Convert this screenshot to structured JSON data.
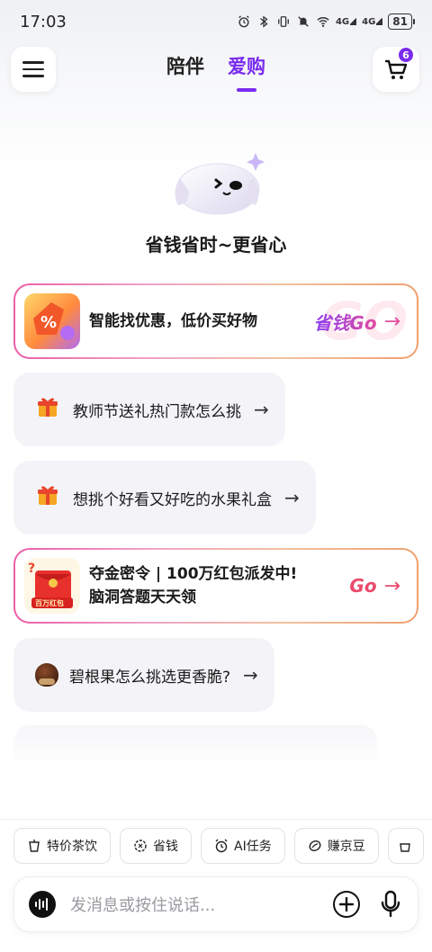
{
  "status_bar": {
    "time": "17:03",
    "network1": "4G",
    "network2": "4G",
    "battery": "81"
  },
  "header": {
    "tabs": [
      {
        "label": "陪伴",
        "active": false
      },
      {
        "label": "爱购",
        "active": true
      }
    ],
    "cart_badge": "6",
    "accent_color": "#7a2cf0"
  },
  "hero": {
    "slogan": "省钱省时~更省心"
  },
  "cards": {
    "promo1": {
      "text": "智能找优惠，低价买好物",
      "cta": "省钱Go",
      "arrow": "→",
      "watermark": "GO"
    },
    "sugg1": {
      "icon": "gift-icon",
      "text": "教师节送礼热门款怎么挑",
      "arrow": "→"
    },
    "sugg2": {
      "icon": "gift-icon",
      "text": "想挑个好看又好吃的水果礼盒",
      "arrow": "→"
    },
    "promo2": {
      "line1": "夺金密令 | 100万红包派发中!",
      "line2": "脑洞答题天天领",
      "thumb_label": "百万红包",
      "cta": "Go",
      "arrow": "→"
    },
    "sugg3": {
      "icon": "chestnut-icon",
      "text": "碧根果怎么挑选更香脆?",
      "arrow": "→"
    }
  },
  "chips": [
    {
      "label": "特价茶饮",
      "icon": "cup-icon"
    },
    {
      "label": "省钱",
      "icon": "coupon-icon"
    },
    {
      "label": "AI任务",
      "icon": "alarm-icon"
    },
    {
      "label": "赚京豆",
      "icon": "bean-icon"
    }
  ],
  "input": {
    "placeholder": "发消息或按住说话..."
  }
}
